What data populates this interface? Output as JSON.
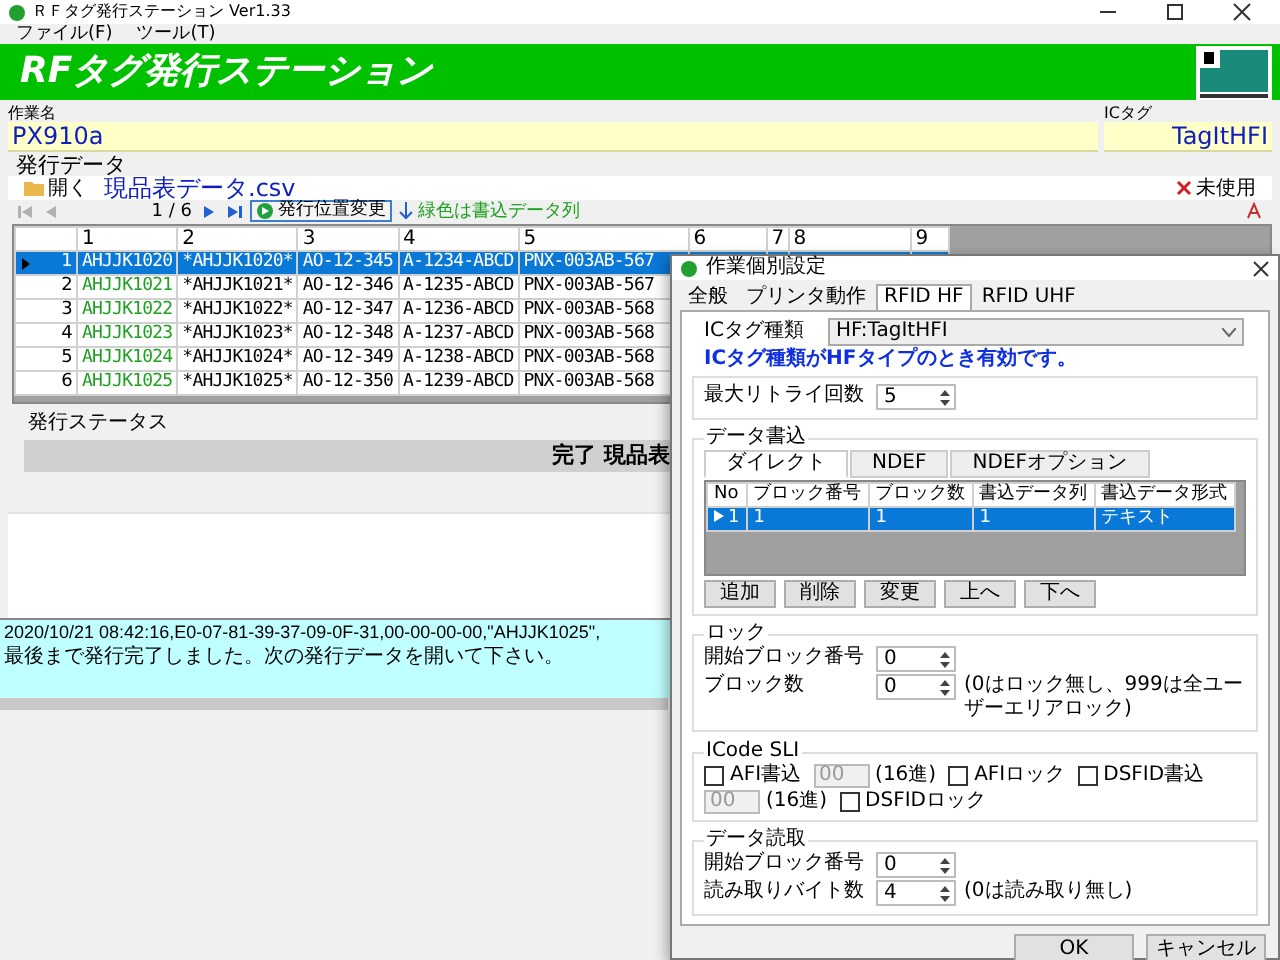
{
  "window": {
    "title": "ＲＦタグ発行ステーション Ver1.33"
  },
  "menu": [
    "ファイル(F)",
    "ツール(T)"
  ],
  "banner": {
    "title": "RFタグ発行ステーション"
  },
  "job": {
    "label": "作業名",
    "value": "PX910a"
  },
  "ic_tag": {
    "label": "ICタグ",
    "value": "TagItHFI"
  },
  "issue_data": {
    "title": "発行データ",
    "open_button": "開く",
    "file_name": "現品表データ.csv",
    "unused_button": "未使用",
    "page": "1 / 6",
    "move_button": "発行位置変更",
    "legend": "緑色は書込データ列",
    "nav": [
      {
        "kind": "first",
        "disabled": true
      },
      {
        "kind": "prev",
        "disabled": true
      },
      {
        "kind": "next",
        "disabled": false
      },
      {
        "kind": "last",
        "disabled": false
      }
    ]
  },
  "table": {
    "columns": [
      {
        "label": "1",
        "write": true
      },
      {
        "label": "2",
        "write": false
      },
      {
        "label": "3",
        "write": false
      },
      {
        "label": "4",
        "write": false
      },
      {
        "label": "5",
        "write": false
      },
      {
        "label": "6"
      },
      {
        "label": "7"
      },
      {
        "label": "8"
      },
      {
        "label": "9"
      }
    ],
    "rows": [
      {
        "number": "1",
        "selected": true,
        "cells": [
          "AHJJK1020",
          "*AHJJK1020*",
          "AO-12-345",
          "A-1234-ABCD",
          "PNX-003AB-567"
        ]
      },
      {
        "number": "2",
        "selected": false,
        "cells": [
          "AHJJK1021",
          "*AHJJK1021*",
          "AO-12-346",
          "A-1235-ABCD",
          "PNX-003AB-567"
        ]
      },
      {
        "number": "3",
        "selected": false,
        "cells": [
          "AHJJK1022",
          "*AHJJK1022*",
          "AO-12-347",
          "A-1236-ABCD",
          "PNX-003AB-568"
        ]
      },
      {
        "number": "4",
        "selected": false,
        "cells": [
          "AHJJK1023",
          "*AHJJK1023*",
          "AO-12-348",
          "A-1237-ABCD",
          "PNX-003AB-568"
        ]
      },
      {
        "number": "5",
        "selected": false,
        "cells": [
          "AHJJK1024",
          "*AHJJK1024*",
          "AO-12-349",
          "A-1238-ABCD",
          "PNX-003AB-568"
        ]
      },
      {
        "number": "6",
        "selected": false,
        "cells": [
          "AHJJK1025",
          "*AHJJK1025*",
          "AO-12-350",
          "A-1239-ABCD",
          "PNX-003AB-568"
        ]
      }
    ]
  },
  "status": {
    "title": "発行ステータス",
    "message": "完了 現品表"
  },
  "log": [
    "2020/10/21 08:42:16,E0-07-81-39-37-09-0F-31,00-00-00-00,\"AHJJK1025\",",
    "最後まで発行完了しました。次の発行データを開いて下さい。"
  ],
  "dialog": {
    "title": "作業個別設定",
    "tabs": [
      {
        "label": "全般",
        "selected": false
      },
      {
        "label": "プリンタ動作",
        "selected": false
      },
      {
        "label": "RFID HF",
        "selected": true
      },
      {
        "label": "RFID UHF",
        "selected": false
      }
    ],
    "tag_type": {
      "label": "ICタグ種類",
      "value": "HF:TagItHFI"
    },
    "note": "ICタグ種類がHFタイプのとき有効です。",
    "retry": {
      "label": "最大リトライ回数",
      "value": "5"
    },
    "write": {
      "title": "データ書込",
      "tabs": [
        {
          "label": "ダイレクト",
          "selected": true
        },
        {
          "label": "NDEF",
          "selected": false
        },
        {
          "label": "NDEFオプション",
          "selected": false
        }
      ],
      "columns": [
        "No",
        "ブロック番号",
        "ブロック数",
        "書込データ列",
        "書込データ形式"
      ],
      "rows": [
        {
          "cells": [
            "1",
            "1",
            "1",
            "1",
            "テキスト"
          ],
          "selected": true
        }
      ],
      "buttons": [
        "追加",
        "削除",
        "変更",
        "上へ",
        "下へ"
      ]
    },
    "lock": {
      "title": "ロック",
      "fields": [
        {
          "label": "開始ブロック番号",
          "value": "0"
        },
        {
          "label": "ブロック数",
          "value": "0",
          "note": "(0はロック無し、999は全ユーザーエリアロック)"
        }
      ]
    },
    "icode": {
      "title": "ICode SLI",
      "items": [
        {
          "kind": "checkbox",
          "label": "AFI書込",
          "checked": false
        },
        {
          "kind": "hex",
          "value": "00",
          "suffix": "(16進)",
          "disabled": true
        },
        {
          "kind": "checkbox",
          "label": "AFIロック",
          "checked": false
        },
        {
          "kind": "checkbox",
          "label": "DSFID書込",
          "checked": false
        },
        {
          "kind": "hex",
          "value": "00",
          "suffix": "(16進)",
          "disabled": true
        },
        {
          "kind": "checkbox",
          "label": "DSFIDロック",
          "checked": false
        }
      ]
    },
    "read": {
      "title": "データ読取",
      "fields": [
        {
          "label": "開始ブロック番号",
          "value": "0"
        },
        {
          "label": "読み取りバイト数",
          "value": "4",
          "note": "(0は読み取り無し)"
        }
      ]
    },
    "buttons": [
      "OK",
      "キャンセル"
    ]
  }
}
